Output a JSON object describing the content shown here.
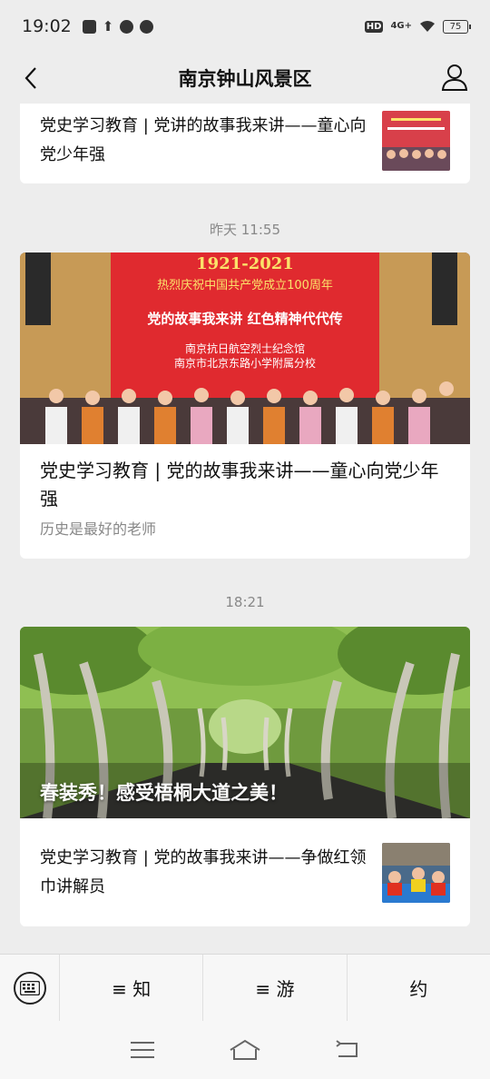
{
  "status": {
    "time": "19:02",
    "hd": "HD",
    "signal": "4G+",
    "battery": "75"
  },
  "nav": {
    "title": "南京钟山风景区"
  },
  "feed": {
    "item_top": {
      "title": "党史学习教育 | 党讲的故事我来讲——童心向党少年强"
    },
    "ts1": "昨天 11:55",
    "article1": {
      "banner_year": "1921-2021",
      "banner_line1": "热烈庆祝中国共产党成立100周年",
      "banner_line2": "党的故事我来讲    红色精神代代传",
      "banner_line3": "南京抗日航空烈士纪念馆",
      "banner_line4": "南京市北京东路小学附属分校",
      "title": "党史学习教育 | 党的故事我来讲——童心向党少年强",
      "digest": "历史是最好的老师"
    },
    "ts2": "18:21",
    "article2": {
      "cover_caption": "春装秀！感受梧桐大道之美！",
      "sub_title": "党史学习教育 | 党的故事我来讲——争做红领巾讲解员"
    }
  },
  "menu": {
    "items": [
      "≡ 知",
      "≡ 游",
      "约"
    ]
  }
}
